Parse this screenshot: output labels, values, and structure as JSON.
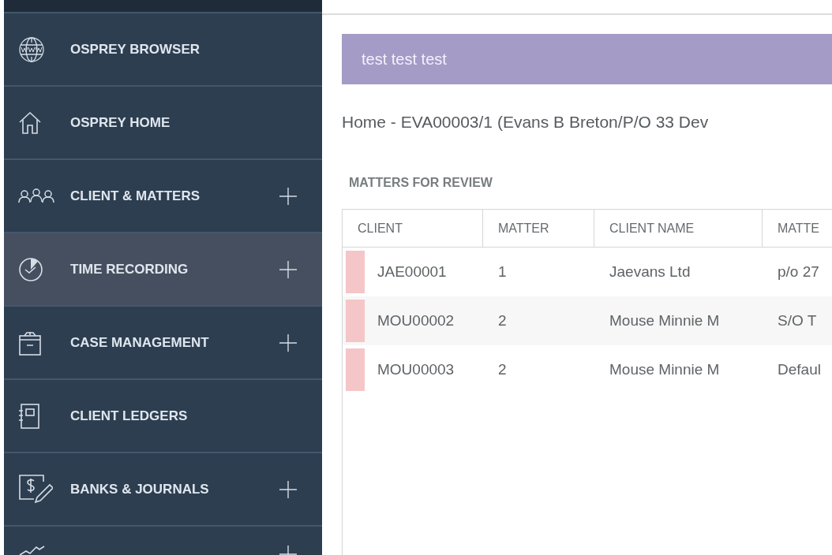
{
  "sidebar": {
    "items": [
      {
        "label": "OSPREY BROWSER",
        "expandable": false,
        "selected": false
      },
      {
        "label": "OSPREY HOME",
        "expandable": false,
        "selected": false
      },
      {
        "label": "CLIENT & MATTERS",
        "expandable": true,
        "selected": false
      },
      {
        "label": "TIME RECORDING",
        "expandable": true,
        "selected": true
      },
      {
        "label": "CASE MANAGEMENT",
        "expandable": true,
        "selected": false
      },
      {
        "label": "CLIENT LEDGERS",
        "expandable": false,
        "selected": false
      },
      {
        "label": "BANKS & JOURNALS",
        "expandable": true,
        "selected": false
      },
      {
        "expandable": true,
        "selected": false
      }
    ]
  },
  "banner": {
    "text": "test test test"
  },
  "page_title": "Home - EVA00003/1 (Evans B Breton/P/O 33 Dev",
  "section_title": "MATTERS FOR REVIEW",
  "table": {
    "columns": [
      "CLIENT",
      "MATTER",
      "CLIENT NAME",
      "MATTE"
    ],
    "rows": [
      {
        "color": "#f4c6c8",
        "cells": [
          "JAE00001",
          "1",
          "Jaevans Ltd",
          "p/o 27"
        ]
      },
      {
        "color": "#f4c6c8",
        "cells": [
          "MOU00002",
          "2",
          "Mouse Minnie M",
          "S/O T"
        ]
      },
      {
        "color": "#f4c6c8",
        "cells": [
          "MOU00003",
          "2",
          "Mouse Minnie M",
          "Defaul"
        ]
      }
    ]
  }
}
